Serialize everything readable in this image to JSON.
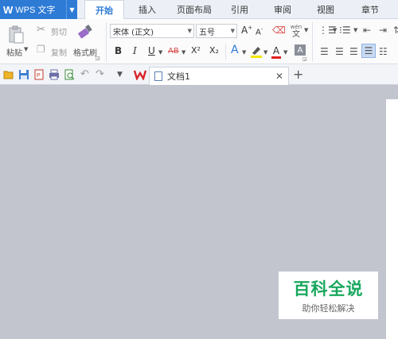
{
  "app": {
    "logo": "W",
    "title": "WPS 文字"
  },
  "tabs": [
    {
      "label": "开始"
    },
    {
      "label": "插入"
    },
    {
      "label": "页面布局"
    },
    {
      "label": "引用"
    },
    {
      "label": "审阅"
    },
    {
      "label": "视图"
    },
    {
      "label": "章节"
    }
  ],
  "ribbon": {
    "paste_label": "粘贴",
    "cut_label": "剪切",
    "copy_label": "复制",
    "format_painter_label": "格式刷",
    "font_name": "宋体 (正文)",
    "font_size": "五号",
    "bold": "B",
    "italic": "I",
    "underline": "U",
    "strike": "AB",
    "superscript": "X²",
    "subscript": "X₂",
    "wen_top": "wén",
    "wen_bottom": "文"
  },
  "document": {
    "tab_name": "文档1"
  },
  "watermark": {
    "title": "百科全说",
    "subtitle": "助你轻松解决"
  },
  "colors": {
    "accent": "#2e7bd6",
    "workspace": "#c2c5cd",
    "watermark_green": "#19a85e"
  }
}
